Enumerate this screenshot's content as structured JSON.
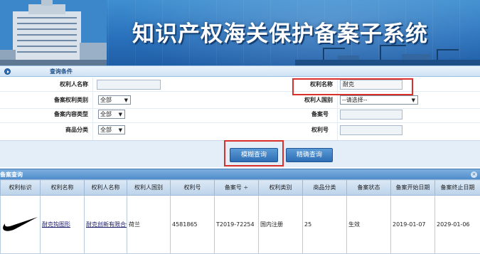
{
  "banner": {
    "title": "知识产权海关保护备案子系统"
  },
  "search": {
    "section_title": "查询条件",
    "fields": {
      "right_holder_label": "权利人名称",
      "right_holder_value": "",
      "right_name_label": "权利名称",
      "right_name_value": "耐克",
      "record_type_label": "备案权利类别",
      "record_type_value": "全部",
      "country_label": "权利人国别",
      "country_value": "--请选择--",
      "content_type_label": "备案内容类型",
      "content_type_value": "全部",
      "record_no_label": "备案号",
      "record_no_value": "",
      "goods_class_label": "商品分类",
      "goods_class_value": "全部",
      "right_no_label": "权利号",
      "right_no_value": ""
    },
    "buttons": {
      "fuzzy": "模糊查询",
      "exact": "精确查询"
    }
  },
  "results": {
    "section_title": "备案查询",
    "close_icon": "close-icon",
    "columns": [
      "权利标识",
      "权利名称",
      "权利人名称",
      "权利人国别",
      "权利号",
      "备案号 ÷",
      "权利类别",
      "商品分类",
      "备案状态",
      "备案开始日期",
      "备案终止日期"
    ],
    "rows": [
      {
        "logo": "nike-swoosh",
        "right_name": "耐克钩图形",
        "holder": "耐克创新有限合伙",
        "country": "荷兰",
        "right_no": "4581865",
        "record_no": "T2019-72254",
        "category": "国内注册",
        "goods_class": "25",
        "status": "生效",
        "start": "2019-01-07",
        "end": "2029-01-06"
      }
    ]
  },
  "colors": {
    "banner": "#2a72bd",
    "highlight": "#d9302c",
    "button": "#2d6db3"
  }
}
